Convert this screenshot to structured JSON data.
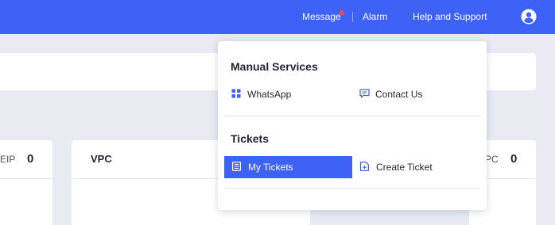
{
  "topbar": {
    "message_label": "Message",
    "alarm_label": "Alarm",
    "help_label": "Help and Support"
  },
  "cards": {
    "left_label": "EIP",
    "left_value": "0",
    "vpc_title": "VPC",
    "right_label": "PC",
    "right_value": "0"
  },
  "dropdown": {
    "manual_services_title": "Manual Services",
    "whatsapp_label": "WhatsApp",
    "contact_us_label": "Contact Us",
    "tickets_title": "Tickets",
    "my_tickets_label": "My Tickets",
    "create_ticket_label": "Create Ticket"
  },
  "colors": {
    "brand_blue": "#3d62f5",
    "notification_dot": "#ff4a3a",
    "page_background": "#e8ebf2"
  },
  "icons": {
    "avatar": "user-avatar-icon",
    "whatsapp": "grid-apps-icon",
    "contact_us": "chat-bubble-icon",
    "my_tickets": "ticket-list-icon",
    "create_ticket": "file-add-icon"
  }
}
